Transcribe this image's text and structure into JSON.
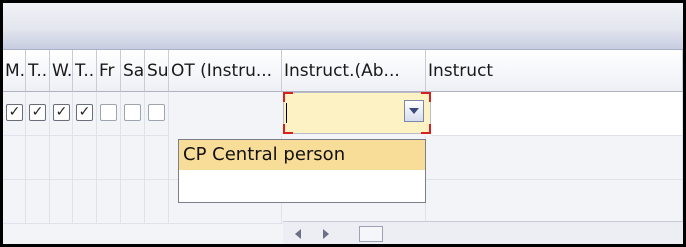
{
  "columns": [
    {
      "label": "M."
    },
    {
      "label": "T.."
    },
    {
      "label": "W."
    },
    {
      "label": "T.."
    },
    {
      "label": "Fr"
    },
    {
      "label": "Sa"
    },
    {
      "label": "Su"
    },
    {
      "label": "OT (Instru..."
    },
    {
      "label": "Instruct.(Ab..."
    },
    {
      "label": "Instruct"
    }
  ],
  "row1": {
    "checks": [
      "✓",
      "✓",
      "✓",
      "✓",
      "",
      "",
      ""
    ],
    "ot_value": ""
  },
  "dropdown": {
    "options": [
      {
        "label": "CP  Central person"
      },
      {
        "label": ""
      }
    ]
  },
  "icons": {
    "dropdown": "chevron-down-icon",
    "scroll_left": "arrow-left-icon",
    "scroll_right": "arrow-right-icon"
  },
  "colors": {
    "active_cell": "#fdf2c4",
    "highlight_option": "#f8dd99",
    "focus_corners": "#d82020"
  }
}
